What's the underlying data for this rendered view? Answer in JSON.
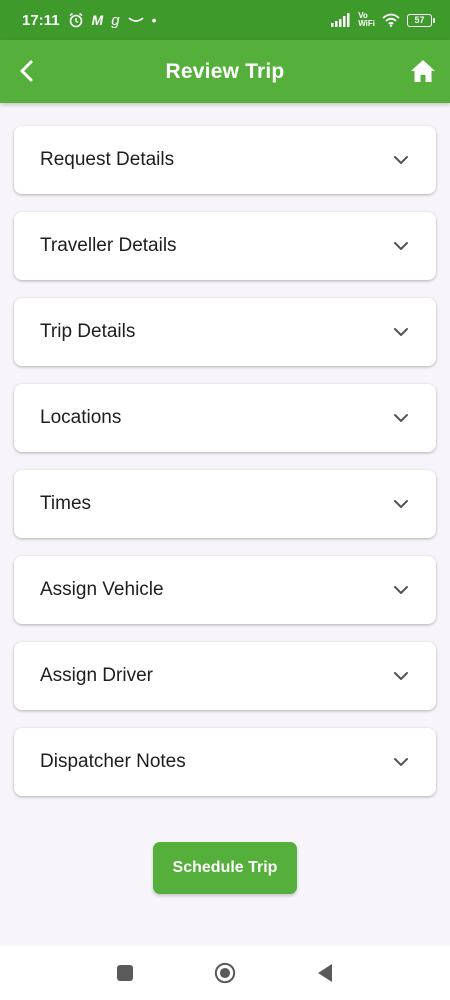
{
  "status_bar": {
    "time": "17:11",
    "notif_m": "M",
    "notif_g": "g",
    "vo": "Vo",
    "wifi_label": "WiFi",
    "battery": "57"
  },
  "app_bar": {
    "title": "Review Trip"
  },
  "sections": [
    {
      "label": "Request Details"
    },
    {
      "label": "Traveller Details"
    },
    {
      "label": "Trip Details"
    },
    {
      "label": "Locations"
    },
    {
      "label": "Times"
    },
    {
      "label": "Assign Vehicle"
    },
    {
      "label": "Assign Driver"
    },
    {
      "label": "Dispatcher Notes"
    }
  ],
  "actions": {
    "schedule_label": "Schedule Trip"
  },
  "colors": {
    "status_bar": "#3f9a2c",
    "primary": "#54b03a",
    "background": "#f7f5f9"
  }
}
